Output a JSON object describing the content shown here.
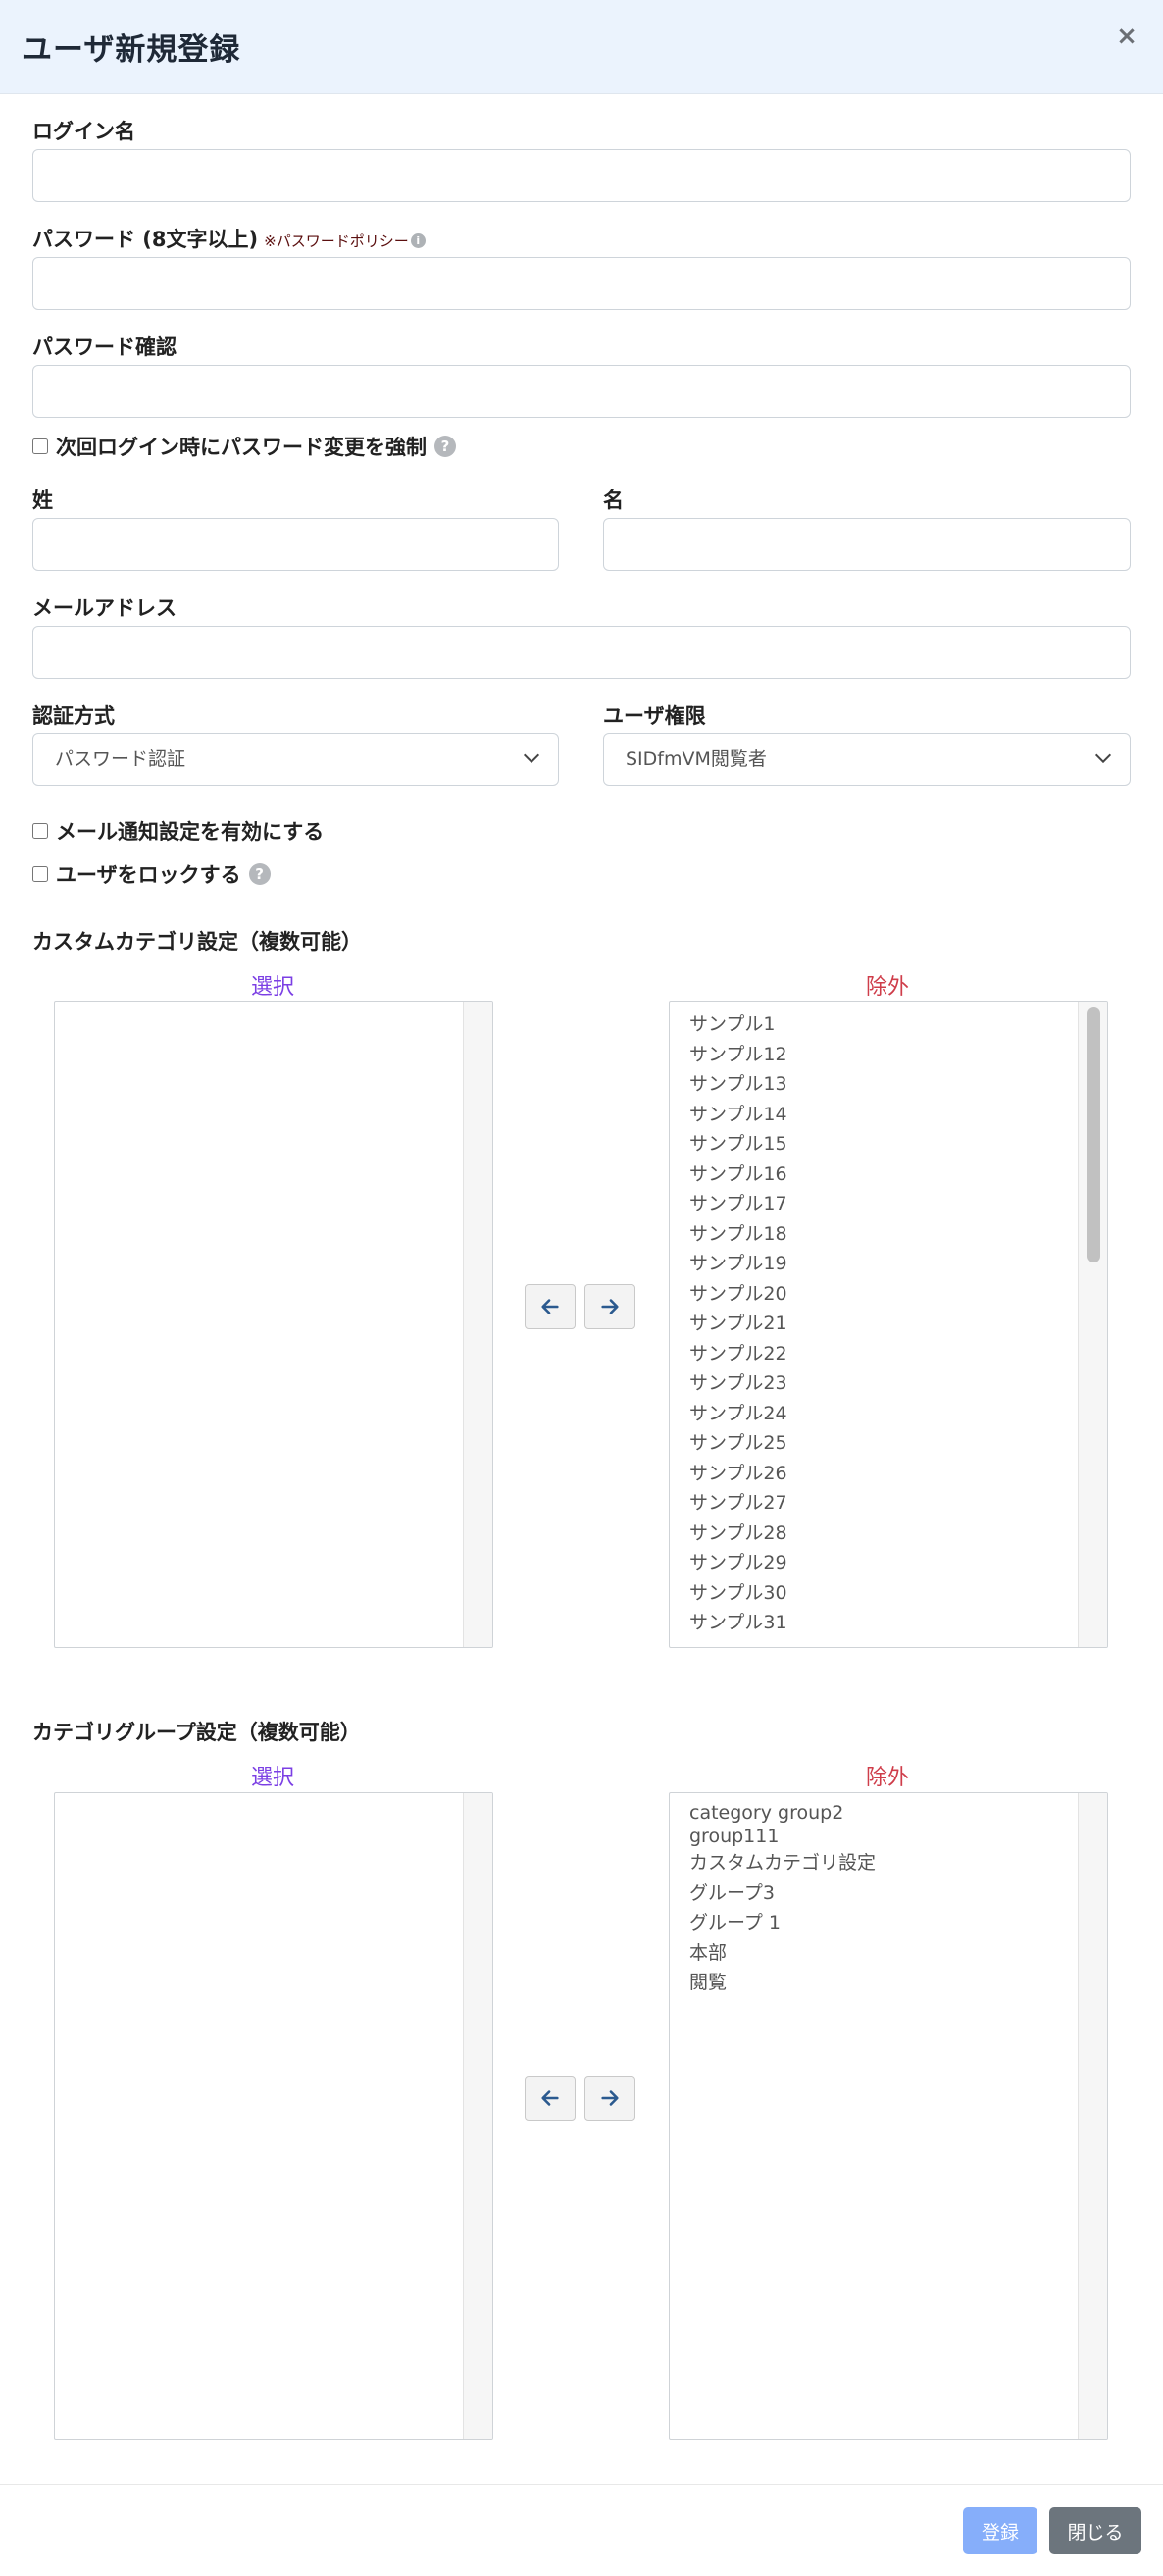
{
  "header": {
    "title": "ユーザ新規登録",
    "close_symbol": "×"
  },
  "form": {
    "login_name": {
      "label": "ログイン名",
      "value": ""
    },
    "password": {
      "label": "パスワード (8文字以上)",
      "policy_note": "※パスワードポリシー",
      "value": ""
    },
    "password_confirm": {
      "label": "パスワード確認",
      "value": ""
    },
    "force_change": {
      "label": "次回ログイン時にパスワード変更を強制",
      "checked": false
    },
    "last_name": {
      "label": "姓",
      "value": ""
    },
    "first_name": {
      "label": "名",
      "value": ""
    },
    "email": {
      "label": "メールアドレス",
      "value": ""
    },
    "auth_method": {
      "label": "認証方式",
      "selected": "パスワード認証"
    },
    "user_role": {
      "label": "ユーザ権限",
      "selected": "SIDfmVM閲覧者"
    },
    "mail_notify": {
      "label": "メール通知設定を有効にする",
      "checked": false
    },
    "lock_user": {
      "label": "ユーザをロックする",
      "checked": false
    }
  },
  "custom_category": {
    "title": "カスタムカテゴリ設定（複数可能）",
    "selected_heading": "選択",
    "excluded_heading": "除外",
    "selected_items": [],
    "excluded_items": [
      "サンプル1",
      "サンプル12",
      "サンプル13",
      "サンプル14",
      "サンプル15",
      "サンプル16",
      "サンプル17",
      "サンプル18",
      "サンプル19",
      "サンプル20",
      "サンプル21",
      "サンプル22",
      "サンプル23",
      "サンプル24",
      "サンプル25",
      "サンプル26",
      "サンプル27",
      "サンプル28",
      "サンプル29",
      "サンプル30",
      "サンプル31"
    ]
  },
  "category_group": {
    "title": "カテゴリグループ設定（複数可能）",
    "selected_heading": "選択",
    "excluded_heading": "除外",
    "selected_items": [],
    "excluded_items": [
      "category group2",
      "group111",
      "カスタムカテゴリ設定",
      "グループ3",
      "グループ 1",
      "本部",
      "閲覧"
    ]
  },
  "footer": {
    "register_label": "登録",
    "close_label": "閉じる"
  },
  "icons": {
    "info": "i",
    "help": "?"
  },
  "colors": {
    "header_bg": "#ebf3fd",
    "select_heading": "#7b3fe4",
    "exclude_heading": "#cf3d4a",
    "register_btn": "#86aefa",
    "close_btn": "#6c757d",
    "arrow": "#2b5a8f"
  }
}
